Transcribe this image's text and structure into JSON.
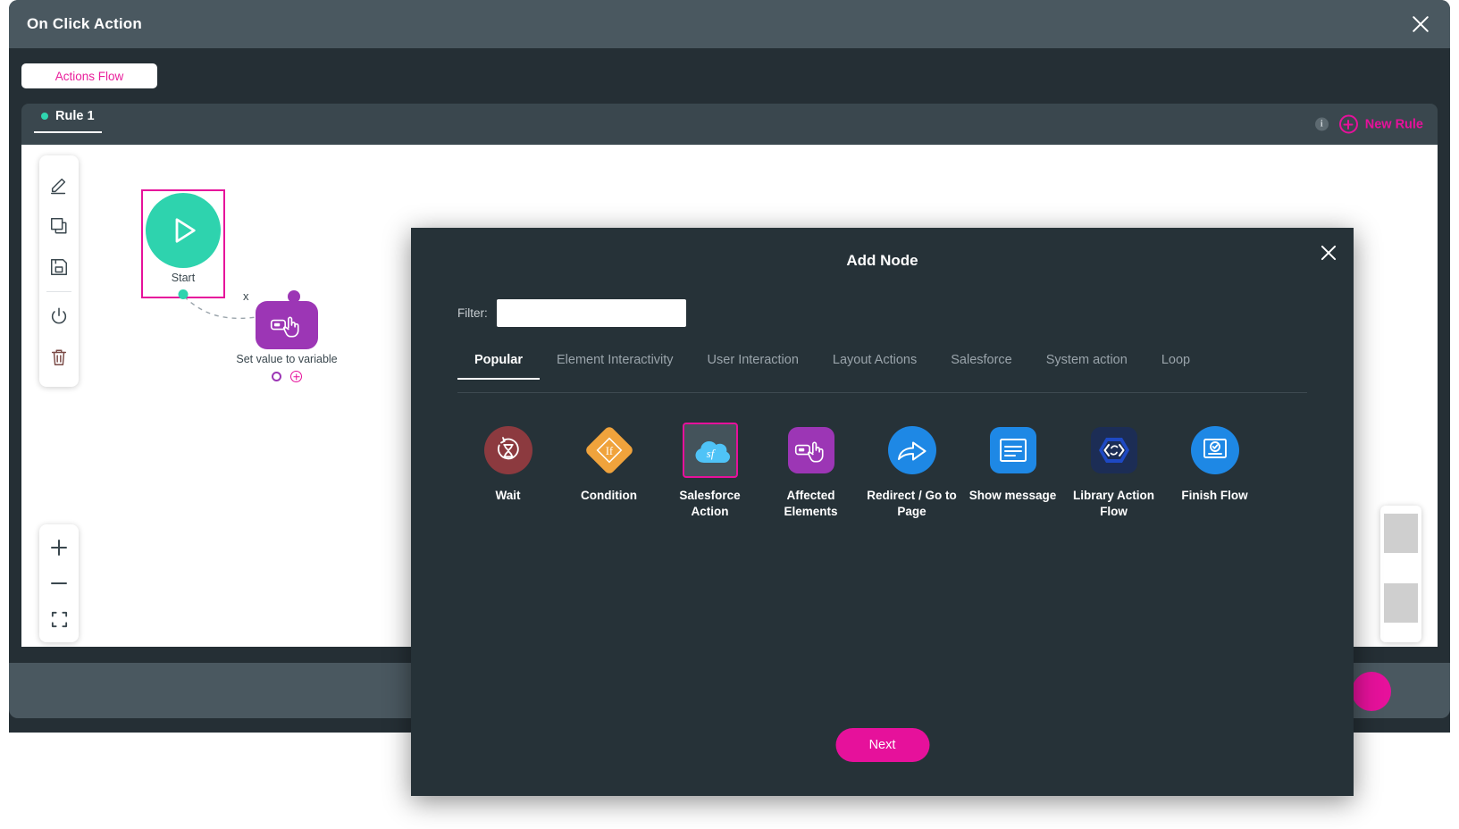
{
  "window": {
    "title": "On Click Action",
    "close_icon": "close-icon"
  },
  "flow_tab": {
    "label": "Actions Flow"
  },
  "rule_bar": {
    "rule_label": "Rule 1",
    "info_icon_char": "i",
    "new_rule_label": "New Rule",
    "accent_color": "#e6119b"
  },
  "toolbar": {
    "items": [
      {
        "name": "edit-icon"
      },
      {
        "name": "copy-icon"
      },
      {
        "name": "save-icon"
      },
      {
        "name": "power-icon"
      },
      {
        "name": "delete-icon"
      }
    ]
  },
  "zoom_controls": {
    "zoom_in": "+",
    "zoom_out": "−",
    "fit": "fit-screen-icon"
  },
  "canvas": {
    "nodes": [
      {
        "id": "start",
        "label": "Start",
        "color": "#2ed3ae",
        "selected": true
      },
      {
        "id": "set-value-to-variable",
        "label": "Set value to variable",
        "color": "#9c36b5",
        "selected": false
      }
    ],
    "edge_label": "x"
  },
  "modal": {
    "title": "Add Node",
    "close_icon": "close-icon",
    "filter": {
      "label": "Filter:",
      "value": "",
      "placeholder": ""
    },
    "tabs": [
      {
        "label": "Popular",
        "active": true
      },
      {
        "label": "Element Interactivity",
        "active": false
      },
      {
        "label": "User Interaction",
        "active": false
      },
      {
        "label": "Layout Actions",
        "active": false
      },
      {
        "label": "Salesforce",
        "active": false
      },
      {
        "label": "System action",
        "active": false
      },
      {
        "label": "Loop",
        "active": false
      }
    ],
    "nodes": [
      {
        "label": "Wait",
        "icon": "hourglass-icon",
        "color": "#8c3a3f",
        "selected": false
      },
      {
        "label": "Condition",
        "icon": "condition-diamond-icon",
        "color": "#f0a33c",
        "selected": false,
        "glyph": "If"
      },
      {
        "label": "Salesforce Action",
        "icon": "salesforce-cloud-icon",
        "color": "#4fc3f7",
        "selected": true,
        "glyph": "sf"
      },
      {
        "label": "Affected Elements",
        "icon": "hand-cursor-icon",
        "color": "#9c36b5",
        "selected": false
      },
      {
        "label": "Redirect / Go to Page",
        "icon": "share-arrow-icon",
        "color": "#1e88e5",
        "selected": false
      },
      {
        "label": "Show message",
        "icon": "message-box-icon",
        "color": "#1e88e5",
        "selected": false
      },
      {
        "label": "Library Action Flow",
        "icon": "code-refresh-icon",
        "color": "#1c2d55",
        "selected": false
      },
      {
        "label": "Finish Flow",
        "icon": "finish-check-icon",
        "color": "#1e88e5",
        "selected": false
      }
    ],
    "next_label": "Next"
  }
}
